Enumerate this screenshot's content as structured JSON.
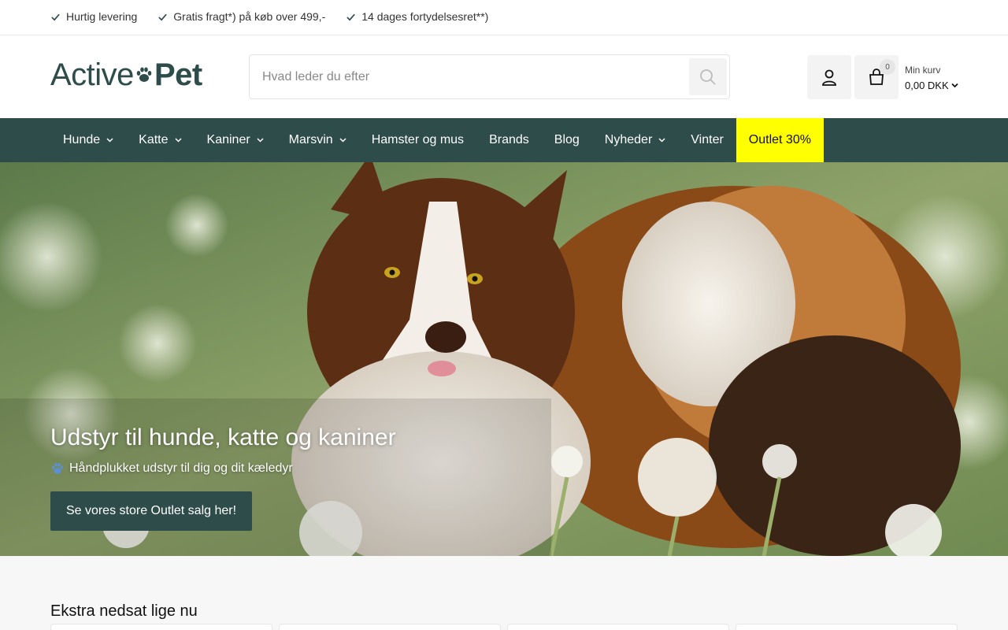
{
  "usp": {
    "items": [
      "Hurtig levering",
      "Gratis fragt*) på køb over 499,-",
      "14 dages fortydelsesret**)"
    ]
  },
  "header": {
    "logo": {
      "part1": "Active",
      "part2": "Pet"
    },
    "search": {
      "placeholder": "Hvad leder du efter"
    },
    "cart": {
      "count": "0",
      "label": "Min kurv",
      "total": "0,00 DKK"
    }
  },
  "nav": {
    "items": [
      {
        "label": "Hunde",
        "has_dropdown": true
      },
      {
        "label": "Katte",
        "has_dropdown": true
      },
      {
        "label": "Kaniner",
        "has_dropdown": true
      },
      {
        "label": "Marsvin",
        "has_dropdown": true
      },
      {
        "label": "Hamster og mus",
        "has_dropdown": false
      },
      {
        "label": "Brands",
        "has_dropdown": false
      },
      {
        "label": "Blog",
        "has_dropdown": false
      },
      {
        "label": "Nyheder",
        "has_dropdown": true
      },
      {
        "label": "Vinter",
        "has_dropdown": false
      },
      {
        "label": "Outlet 30%",
        "has_dropdown": false,
        "highlight": "#ffff00"
      }
    ]
  },
  "hero": {
    "title": "Udstyr til hunde, katte og kaniner",
    "subtitle": "Håndplukket udstyr til dig og dit kæledyr",
    "cta": "Se vores store Outlet salg her!"
  },
  "section": {
    "title": "Ekstra nedsat lige nu"
  },
  "colors": {
    "brand": "#2d4c4a",
    "sale": "#ffff00"
  }
}
